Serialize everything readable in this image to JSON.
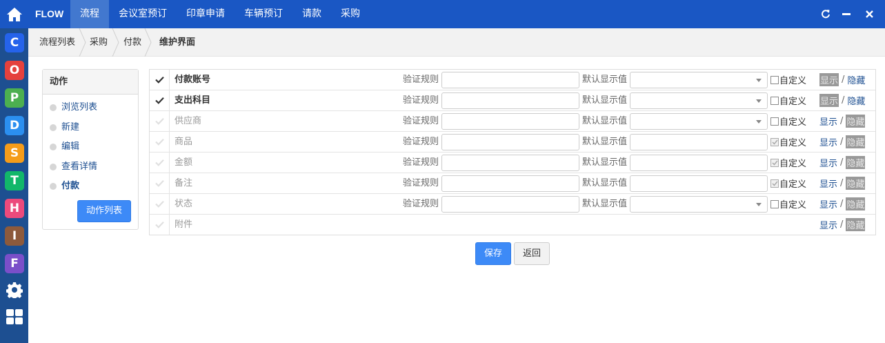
{
  "app": {
    "brand": "FLOW"
  },
  "nav": {
    "items": [
      {
        "label": "流程",
        "active": true
      },
      {
        "label": "会议室预订",
        "active": false
      },
      {
        "label": "印章申请",
        "active": false
      },
      {
        "label": "车辆预订",
        "active": false
      },
      {
        "label": "请款",
        "active": false
      },
      {
        "label": "采购",
        "active": false
      }
    ]
  },
  "rail": {
    "apps": [
      {
        "letter": "C",
        "color": "#2563eb",
        "icon": "app-c-icon"
      },
      {
        "letter": "O",
        "color": "#e5413d",
        "icon": "app-o-icon"
      },
      {
        "letter": "P",
        "color": "#4caf50",
        "icon": "app-p-icon"
      },
      {
        "letter": "D",
        "color": "#2b8ff0",
        "icon": "app-d-icon"
      },
      {
        "letter": "S",
        "color": "#f59c1a",
        "icon": "app-s-icon"
      },
      {
        "letter": "T",
        "color": "#12b76a",
        "icon": "app-t-icon"
      },
      {
        "letter": "H",
        "color": "#ec4a7c",
        "icon": "app-h-icon"
      },
      {
        "letter": "I",
        "color": "#8d5a3c",
        "icon": "app-i-icon"
      },
      {
        "letter": "F",
        "color": "#7a4fc9",
        "icon": "app-f-icon"
      }
    ]
  },
  "breadcrumb": [
    "流程列表",
    "采购",
    "付款",
    "维护界面"
  ],
  "panel": {
    "title": "动作",
    "items": [
      {
        "label": "浏览列表",
        "bold": false
      },
      {
        "label": "新建",
        "bold": false
      },
      {
        "label": "编辑",
        "bold": false
      },
      {
        "label": "查看详情",
        "bold": false
      },
      {
        "label": "付款",
        "bold": true
      }
    ],
    "button": "动作列表"
  },
  "labels": {
    "validation": "验证规则",
    "default_value": "默认显示值",
    "custom": "自定义",
    "show": "显示",
    "hide": "隐藏",
    "slash": "/"
  },
  "fields": [
    {
      "name": "付款账号",
      "enabled": true,
      "default_type": "select",
      "custom_checked": false,
      "visibility": "show"
    },
    {
      "name": "支出科目",
      "enabled": true,
      "default_type": "select",
      "custom_checked": false,
      "visibility": "show"
    },
    {
      "name": "供应商",
      "enabled": false,
      "default_type": "select",
      "custom_checked": false,
      "visibility": "hide"
    },
    {
      "name": "商品",
      "enabled": false,
      "default_type": "input",
      "custom_checked": true,
      "visibility": "hide"
    },
    {
      "name": "金额",
      "enabled": false,
      "default_type": "input",
      "custom_checked": true,
      "visibility": "hide"
    },
    {
      "name": "备注",
      "enabled": false,
      "default_type": "input",
      "custom_checked": true,
      "visibility": "hide"
    },
    {
      "name": "状态",
      "enabled": false,
      "default_type": "select",
      "custom_checked": false,
      "visibility": "hide"
    },
    {
      "name": "附件",
      "enabled": false,
      "default_type": "none",
      "custom_checked": false,
      "visibility": "hide"
    }
  ],
  "actions": {
    "save": "保存",
    "back": "返回"
  }
}
